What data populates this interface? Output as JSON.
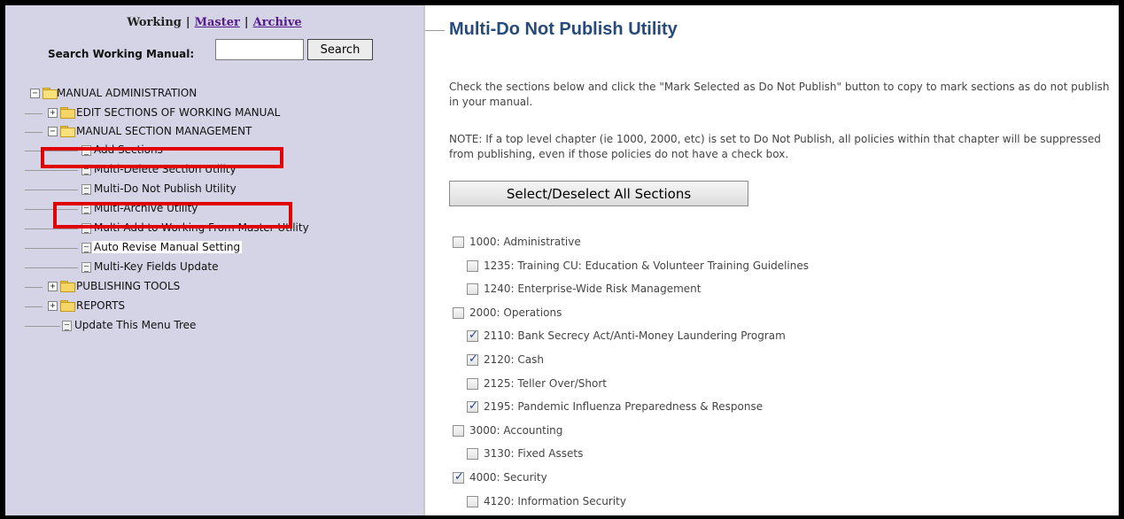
{
  "sidebar": {
    "nav": {
      "working": "Working",
      "separator": "|",
      "master": "Master",
      "archive": "Archive"
    },
    "search": {
      "label": "Search Working Manual:",
      "value": "",
      "button": "Search"
    },
    "tree": {
      "root": "MANUAL ADMINISTRATION",
      "edit_sections": "EDIT SECTIONS OF WORKING MANUAL",
      "section_mgmt": "MANUAL SECTION MANAGEMENT",
      "add_sections": "Add Sections",
      "multi_delete": "Multi-Delete Section Utility",
      "multi_dnp": "Multi-Do Not Publish Utility",
      "multi_archive": "Multi-Archive Utility",
      "multi_add": "Multi-Add to Working From Master Utility",
      "auto_revise": "Auto Revise Manual Setting",
      "multi_key": "Multi-Key Fields Update",
      "publishing_tools": "PUBLISHING TOOLS",
      "reports": "REPORTS",
      "update_tree": "Update This Menu Tree"
    },
    "highlight_color": "#e00000"
  },
  "main": {
    "title": "Multi-Do Not Publish Utility",
    "title_color": "#264a7c",
    "instructions": "Check the sections below and click the \"Mark Selected as Do Not Publish\" button to copy to mark sections as do not publish in your manual.",
    "note": "NOTE: If a top level chapter (ie 1000, 2000, etc) is set to Do Not Publish, all policies within that chapter will be suppressed from publishing, even if those policies do not have a check box.",
    "select_all": "Select/Deselect All Sections",
    "sections": [
      {
        "label": "1000: Administrative",
        "checked": false,
        "level": 0
      },
      {
        "label": "1235: Training CU: Education & Volunteer Training Guidelines",
        "checked": false,
        "level": 1
      },
      {
        "label": "1240: Enterprise-Wide Risk Management",
        "checked": false,
        "level": 1
      },
      {
        "label": "2000: Operations",
        "checked": false,
        "level": 0
      },
      {
        "label": "2110: Bank Secrecy Act/Anti-Money Laundering Program",
        "checked": true,
        "level": 1
      },
      {
        "label": "2120: Cash",
        "checked": true,
        "level": 1
      },
      {
        "label": "2125: Teller Over/Short",
        "checked": false,
        "level": 1
      },
      {
        "label": "2195: Pandemic Influenza Preparedness & Response",
        "checked": true,
        "level": 1
      },
      {
        "label": "3000: Accounting",
        "checked": false,
        "level": 0
      },
      {
        "label": "3130: Fixed Assets",
        "checked": false,
        "level": 1
      },
      {
        "label": "4000: Security",
        "checked": true,
        "level": 0
      },
      {
        "label": "4120: Information Security",
        "checked": false,
        "level": 1
      }
    ]
  }
}
